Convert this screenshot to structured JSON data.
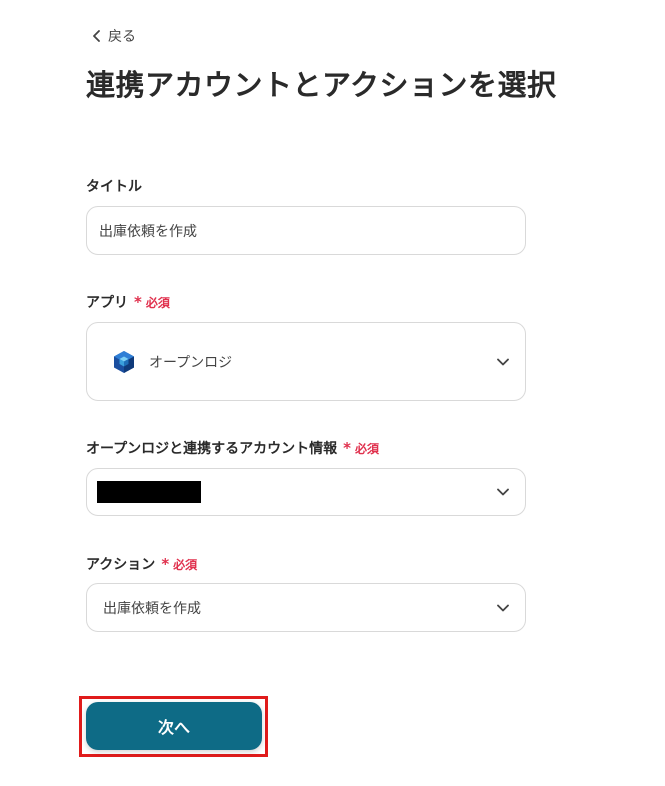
{
  "nav": {
    "back_label": "戻る"
  },
  "page": {
    "title": "連携アカウントとアクションを選択"
  },
  "form": {
    "required_star": "*",
    "required_text": "必須",
    "title_field": {
      "label": "タイトル",
      "value": "出庫依頼を作成"
    },
    "app_field": {
      "label": "アプリ",
      "value": "オープンロジ",
      "icon": "openlogi-cube-icon"
    },
    "account_field": {
      "label": "オープンロジと連携するアカウント情報",
      "value_redacted": true
    },
    "action_field": {
      "label": "アクション",
      "value": "出庫依頼を作成"
    }
  },
  "footer": {
    "next_label": "次へ",
    "highlight_color": "#e01b1b"
  },
  "colors": {
    "primary": "#0e6b86",
    "required": "#e0304d"
  }
}
